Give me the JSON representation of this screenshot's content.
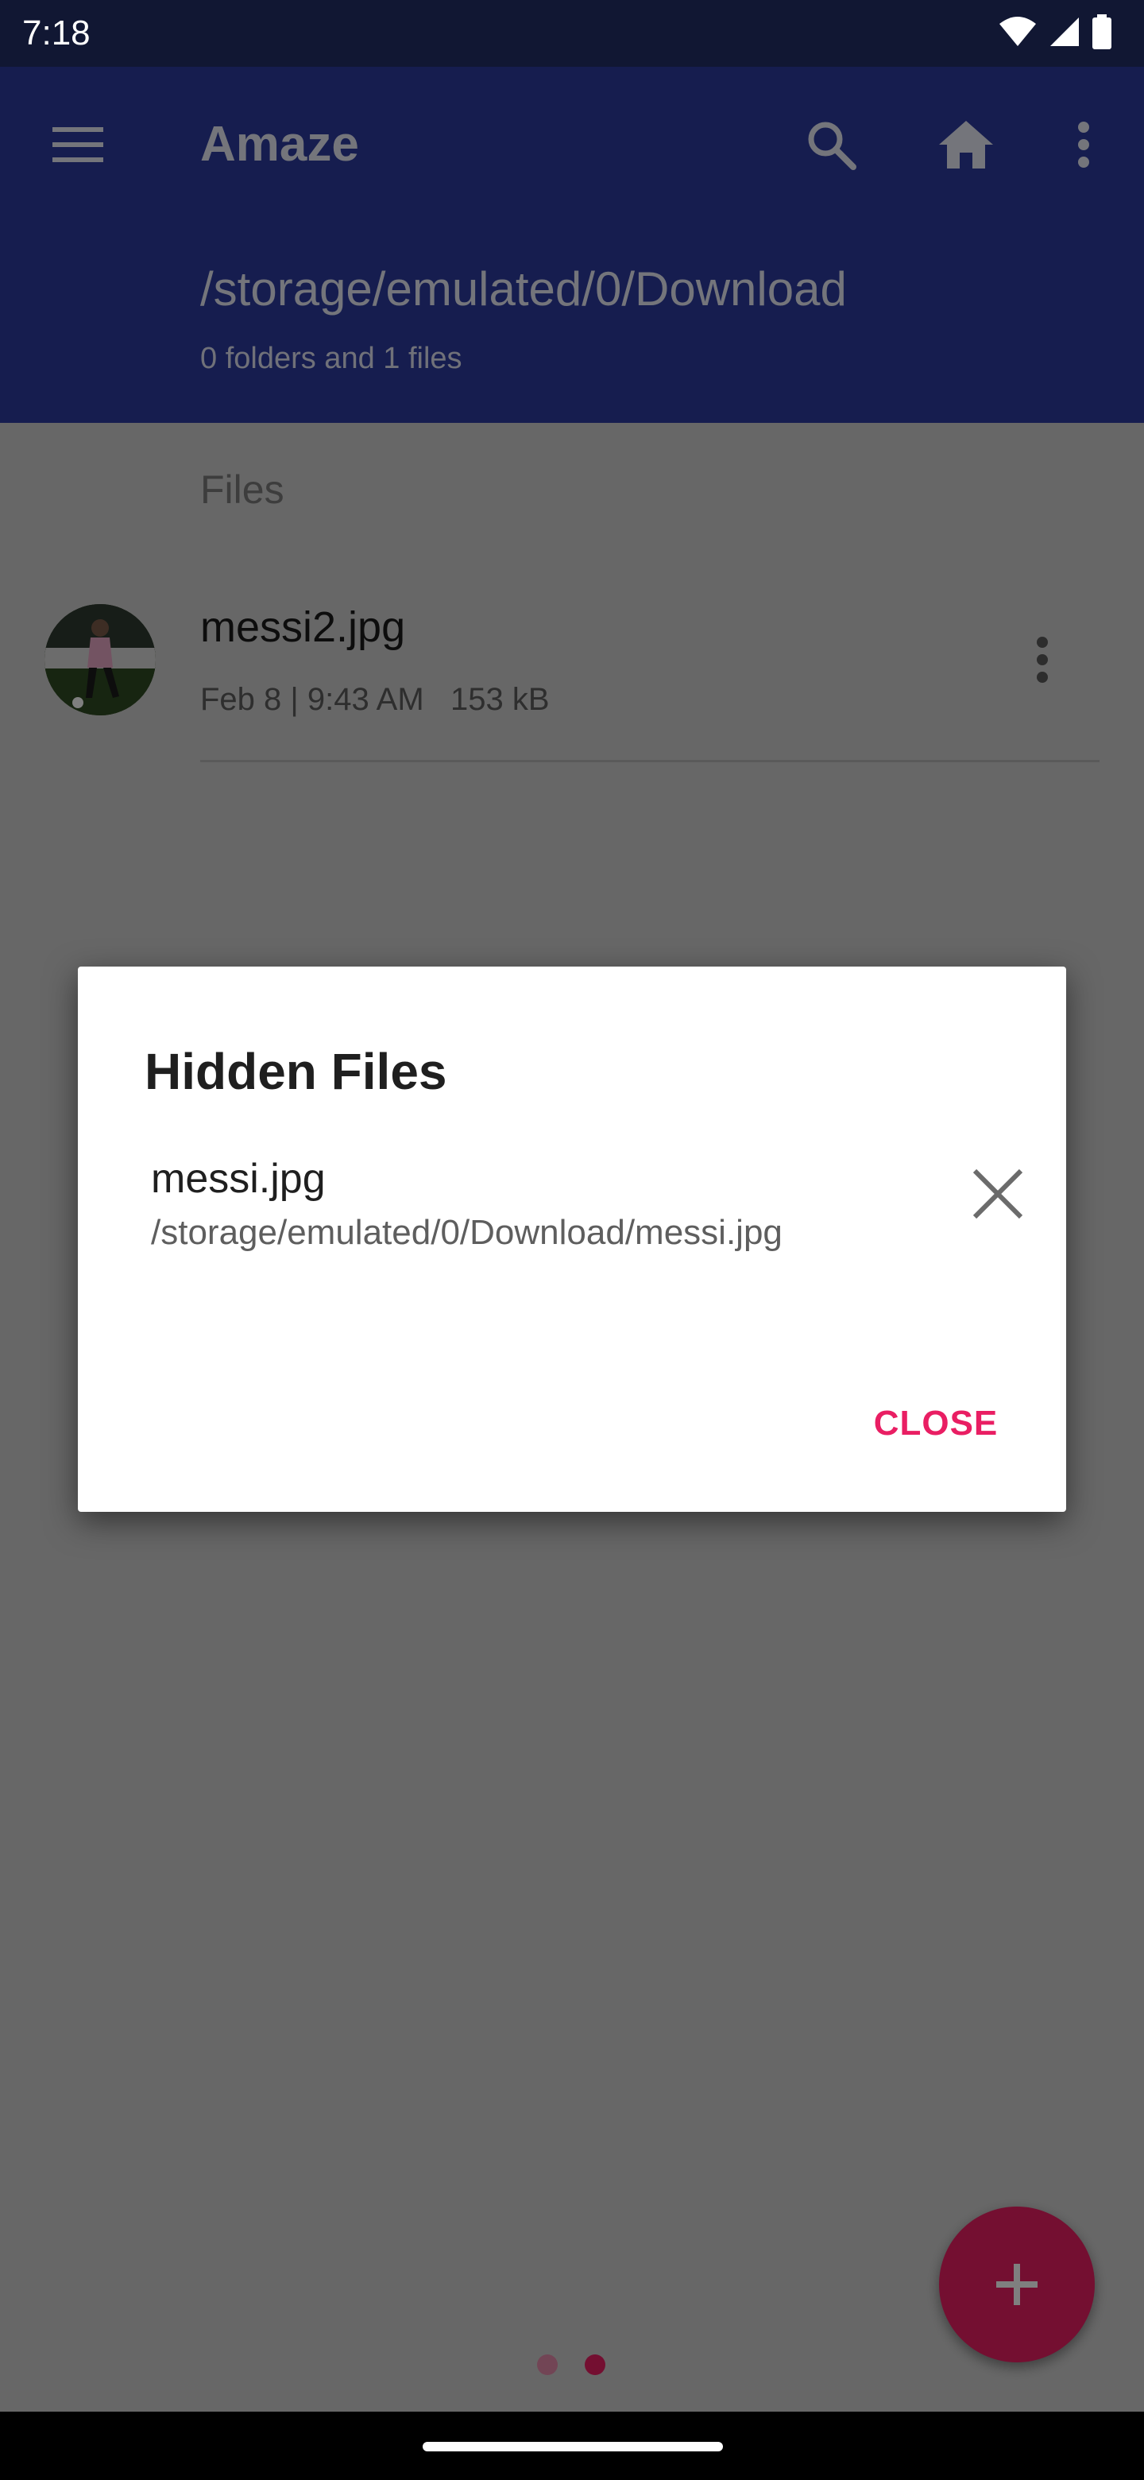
{
  "status_bar": {
    "time": "7:18",
    "icons": [
      "wifi-icon",
      "signal-icon",
      "battery-icon"
    ]
  },
  "app_bar": {
    "title": "Amaze",
    "current_path": "/storage/emulated/0/Download",
    "summary": "0 folders and 1 files",
    "icons": [
      "menu-icon",
      "search-icon",
      "home-icon",
      "more-vert-icon"
    ],
    "color": "#2c3a9e"
  },
  "content": {
    "section_header": "Files",
    "files": [
      {
        "name": "messi2.jpg",
        "meta": "Feb 8 | 9:43 AM   153 kB",
        "thumbnail": "image-thumbnail"
      }
    ]
  },
  "dialog": {
    "title": "Hidden Files",
    "items": [
      {
        "name": "messi.jpg",
        "path": "/storage/emulated/0/Download/messi.jpg"
      }
    ],
    "close_label": "CLOSE",
    "accent_color": "#e91e63"
  },
  "fab": {
    "icon": "plus-icon",
    "color": "#e91e63"
  },
  "pager": {
    "page_count": 2,
    "active_index": 1
  }
}
